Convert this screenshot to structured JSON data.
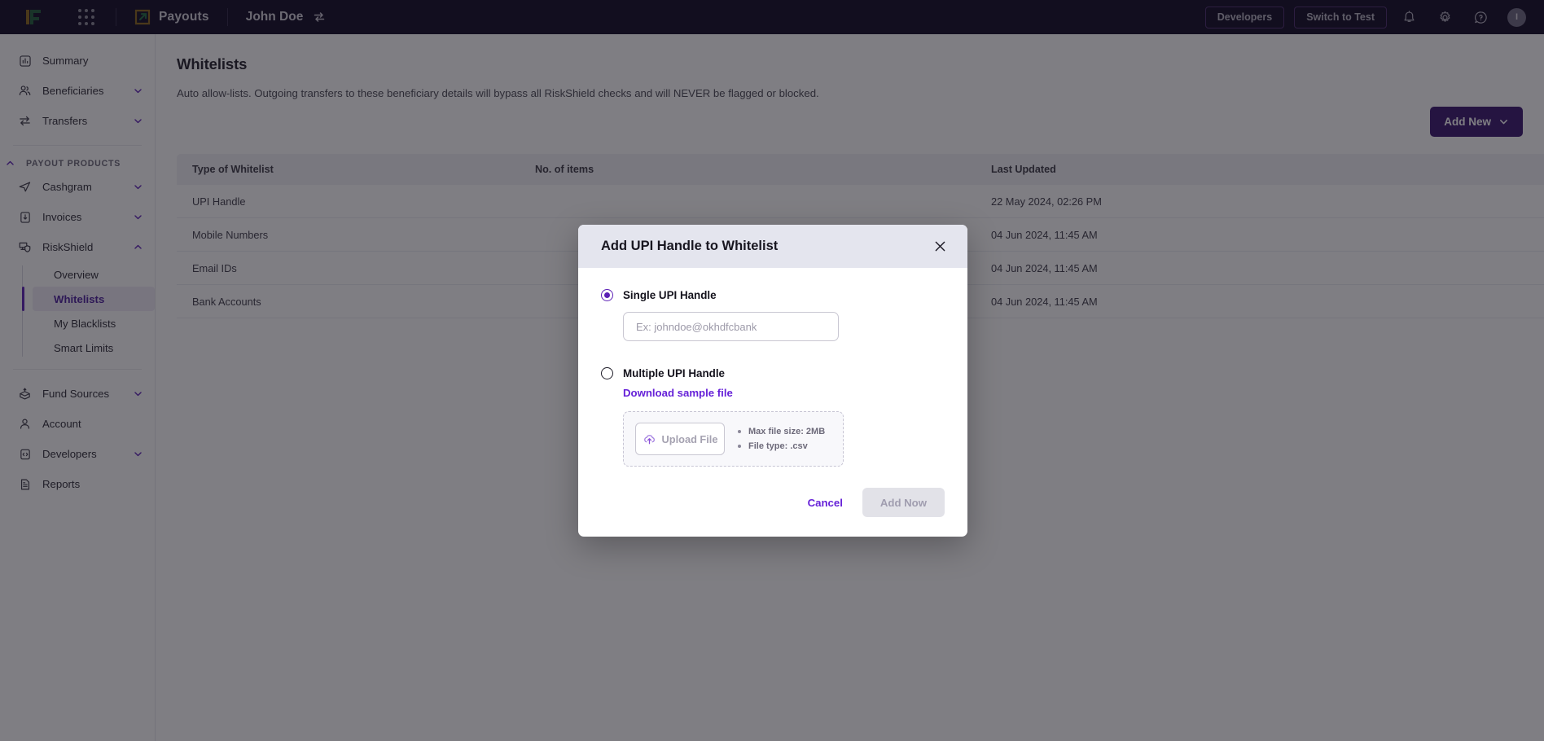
{
  "topbar": {
    "logo_icon": "finance-f-logo-icon",
    "apps_icon": "app-grid-icon",
    "app_name": "Payouts",
    "app_icon": "payouts-arrow-icon",
    "account_name": "John Doe",
    "switch_account_icon": "switch-account-icon",
    "developers_label": "Developers",
    "switch_to_test_label": "Switch to Test",
    "notifications_icon": "bell-icon",
    "settings_icon": "gear-icon",
    "help_icon": "help-circle-icon",
    "avatar_initial": "I"
  },
  "sidebar": {
    "items": [
      {
        "label": "Summary",
        "icon": "chart-bar-icon",
        "expandable": false
      },
      {
        "label": "Beneficiaries",
        "icon": "users-icon",
        "expandable": true
      },
      {
        "label": "Transfers",
        "icon": "transfer-arrows-icon",
        "expandable": true
      }
    ],
    "section_label": "PAYOUT PRODUCTS",
    "products": [
      {
        "label": "Cashgram",
        "icon": "paper-plane-icon",
        "expandable": true
      },
      {
        "label": "Invoices",
        "icon": "invoice-doc-icon",
        "expandable": true
      },
      {
        "label": "RiskShield",
        "icon": "shield-monitor-icon",
        "expandable": true,
        "expanded": true
      }
    ],
    "riskshield_children": [
      {
        "label": "Overview",
        "active": false
      },
      {
        "label": "Whitelists",
        "active": true
      },
      {
        "label": "My Blacklists",
        "active": false
      },
      {
        "label": "Smart Limits",
        "active": false
      }
    ],
    "bottom_items": [
      {
        "label": "Fund Sources",
        "icon": "fund-box-icon",
        "expandable": true
      },
      {
        "label": "Account",
        "icon": "person-icon",
        "expandable": false
      },
      {
        "label": "Developers",
        "icon": "code-clipboard-icon",
        "expandable": true
      },
      {
        "label": "Reports",
        "icon": "report-doc-icon",
        "expandable": false
      }
    ]
  },
  "page": {
    "title": "Whitelists",
    "subtitle": "Auto allow-lists. Outgoing transfers to these beneficiary details will bypass all RiskShield checks and will NEVER be flagged or blocked.",
    "add_new_label": "Add New"
  },
  "table": {
    "columns": [
      "Type of Whitelist",
      "No. of items",
      "Last Updated"
    ],
    "rows": [
      {
        "type": "UPI Handle",
        "items": "",
        "updated": "22 May 2024, 02:26 PM"
      },
      {
        "type": "Mobile Numbers",
        "items": "",
        "updated": "04 Jun 2024, 11:45 AM"
      },
      {
        "type": "Email IDs",
        "items": "",
        "updated": "04 Jun 2024, 11:45 AM"
      },
      {
        "type": "Bank Accounts",
        "items": "",
        "updated": "04 Jun 2024, 11:45 AM"
      }
    ]
  },
  "modal": {
    "title": "Add UPI Handle to Whitelist",
    "close_icon": "close-x-icon",
    "single_option_label": "Single UPI Handle",
    "single_option_selected": true,
    "handle_input_value": "",
    "handle_input_placeholder": "Ex: johndoe@okhdfcbank",
    "multiple_option_label": "Multiple UPI Handle",
    "multiple_option_selected": false,
    "download_sample_label": "Download sample file",
    "upload_button_label": "Upload File",
    "upload_icon": "cloud-upload-icon",
    "constraints": [
      "Max file size: 2MB",
      "File type: .csv"
    ],
    "cancel_label": "Cancel",
    "submit_label": "Add Now",
    "submit_disabled": true
  },
  "colors": {
    "brand_purple": "#5b1fb5",
    "link_purple": "#6621d8",
    "topbar_bg": "#0f0823",
    "button_purple": "#38156e"
  }
}
